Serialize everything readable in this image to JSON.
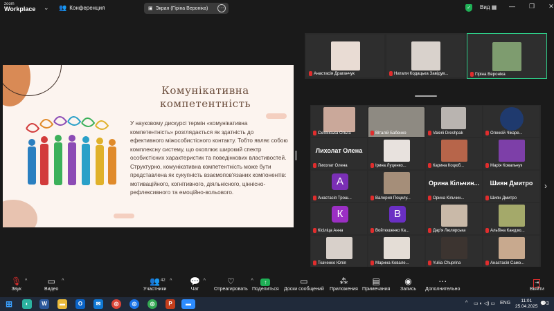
{
  "app": {
    "logo_top": "zoom",
    "logo_bottom": "Workplace",
    "meeting_label": "Конференция"
  },
  "share": {
    "label": "Экран (Гіріна Вероніка)"
  },
  "view_label": "Вид",
  "slide": {
    "title": "Комунікативна компетентність",
    "body": "У науковому дискурсі термін «комунікативна компетентність» розглядається як здатність до ефективного міжособистісного контакту. Тобто являє собою комплексну систему, що охоплює широкий спектр особистісних характеристик та поведінкових властивостей. Структурно, комунікативна компетентність може бути представлена як сукупність взаємопов'язаних компонентів: мотиваційного, когнітивного, діяльнісного, ціннісно-рефлексивного та емоційно-вольового."
  },
  "strip": [
    {
      "name": "Анастасія Драганчук"
    },
    {
      "name": "Натали Кодацька Завідув..."
    },
    {
      "name": "Гіріна Вероніка"
    }
  ],
  "grid": [
    {
      "name": "Склянська Ольга"
    },
    {
      "name": "Віталій Бабенко"
    },
    {
      "name": "Valerii Dreshpak"
    },
    {
      "name": "Олексій Чікаре..."
    },
    {
      "name": "Лихолат Олена",
      "big": "Лихолат Олена"
    },
    {
      "name": "Ірина Луценко..."
    },
    {
      "name": "Карина Коцюб..."
    },
    {
      "name": "Марія Ковальчук"
    },
    {
      "name": "Анастасія Трош...",
      "letter": "А"
    },
    {
      "name": "Валерия Поцелу..."
    },
    {
      "name": "Орина Кільчин...",
      "big": "Орина Кільчин..."
    },
    {
      "name": "Шиян Дмитро",
      "big": "Шиян Дмитро"
    },
    {
      "name": "Кісіліца Анна",
      "letter": "К"
    },
    {
      "name": "Войтюшенко Ка...",
      "letter": "В"
    },
    {
      "name": "Дар'я Люлярська"
    },
    {
      "name": "Альбіна Кандзю..."
    },
    {
      "name": "Ткаченко Юлія"
    },
    {
      "name": "Марина Ковале..."
    },
    {
      "name": "Yuliia Chuprina"
    },
    {
      "name": "Анастасія Само..."
    }
  ],
  "toolbar": {
    "audio": "Звук",
    "video": "Видео",
    "participants": "Участники",
    "participants_count": "42",
    "chat": "Чат",
    "react": "Отреагировать",
    "share": "Поделиться",
    "whiteboard": "Доски сообщений",
    "apps": "Приложения",
    "notes": "Примечания",
    "record": "Запись",
    "more": "Дополнительно",
    "leave": "Выйти"
  },
  "taskbar": {
    "lang": "ENG",
    "time": "11:01",
    "date": "25.04.2025",
    "notif": "3"
  },
  "colors": {
    "accent_green": "#1fb056",
    "mic_red": "#e02d2d",
    "slide_bg": "#fcf4ef",
    "taskbar": "#202a3a"
  }
}
